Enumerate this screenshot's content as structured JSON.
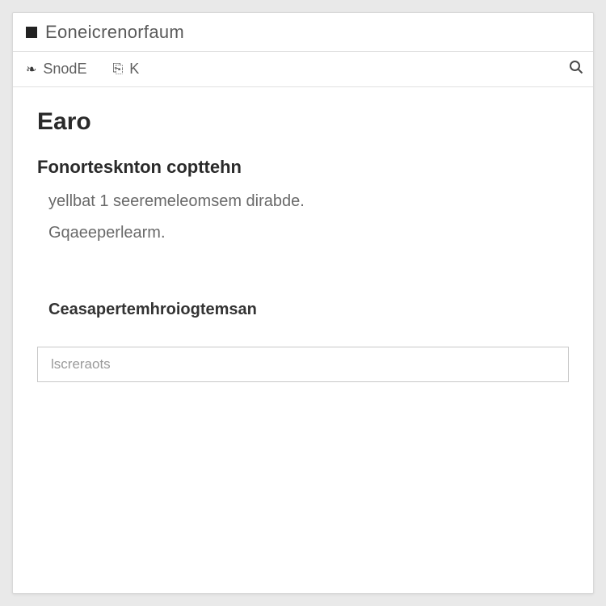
{
  "window": {
    "title": "Eoneicrenorfaum"
  },
  "toolbar": {
    "item1": {
      "label": "SnodE"
    },
    "item2": {
      "label": "K"
    }
  },
  "content": {
    "heading": "Earo",
    "subheading": "Fonortesknton copttehn",
    "p1": "yellbat 1 seeremeleomsem dirabde.",
    "p2": "Gqaeeperlearm.",
    "section_label": "Ceasapertemhroiogtemsan",
    "input_placeholder": "lscreraots"
  }
}
